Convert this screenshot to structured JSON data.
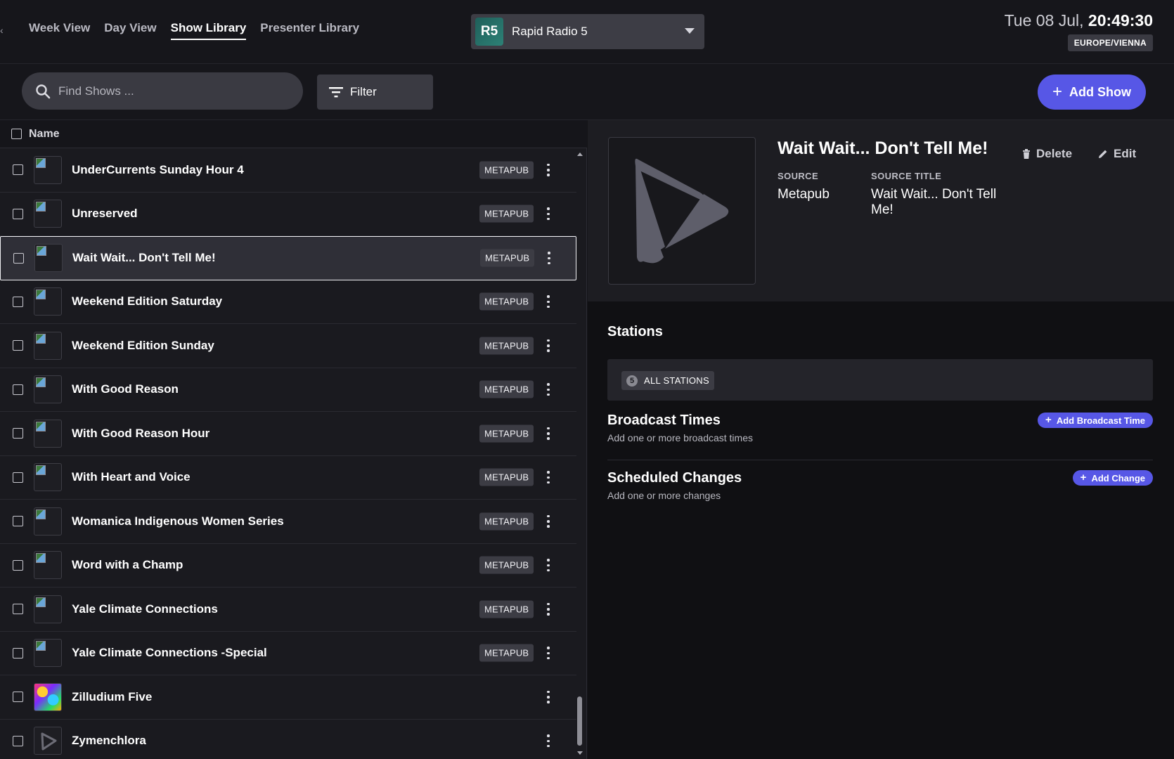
{
  "nav": {
    "back_glyph": "‹",
    "items": [
      {
        "label": "Week View"
      },
      {
        "label": "Day View"
      },
      {
        "label": "Show Library"
      },
      {
        "label": "Presenter Library"
      }
    ],
    "active_item": "Show Library"
  },
  "station_select": {
    "logo_text": "R5",
    "name": "Rapid Radio 5"
  },
  "clock": {
    "date": "Tue 08 Jul,",
    "time": "20:49:30",
    "timezone": "EUROPE/VIENNA"
  },
  "toolbar": {
    "search_placeholder": "Find Shows ...",
    "search_value": "",
    "filter_label": "Filter",
    "add_show_label": "Add Show"
  },
  "list": {
    "header_label": "Name",
    "rows": [
      {
        "title": "UnderCurrents Sunday Hour 4",
        "badge": "METAPUB",
        "thumb": "broken-image"
      },
      {
        "title": "Unreserved",
        "badge": "METAPUB",
        "thumb": "broken-image"
      },
      {
        "title": "Wait Wait... Don't Tell Me!",
        "badge": "METAPUB",
        "thumb": "broken-image"
      },
      {
        "title": "Weekend Edition Saturday",
        "badge": "METAPUB",
        "thumb": "broken-image"
      },
      {
        "title": "Weekend Edition Sunday",
        "badge": "METAPUB",
        "thumb": "broken-image"
      },
      {
        "title": "With Good Reason",
        "badge": "METAPUB",
        "thumb": "broken-image"
      },
      {
        "title": "With Good Reason Hour",
        "badge": "METAPUB",
        "thumb": "broken-image"
      },
      {
        "title": "With Heart and Voice",
        "badge": "METAPUB",
        "thumb": "broken-image"
      },
      {
        "title": "Womanica Indigenous Women Series",
        "badge": "METAPUB",
        "thumb": "broken-image"
      },
      {
        "title": "Word with a Champ",
        "badge": "METAPUB",
        "thumb": "broken-image"
      },
      {
        "title": "Yale Climate Connections",
        "badge": "METAPUB",
        "thumb": "broken-image"
      },
      {
        "title": "Yale Climate Connections -Special",
        "badge": "METAPUB",
        "thumb": "broken-image"
      },
      {
        "title": "Zilludium Five",
        "badge": "",
        "thumb": "colorful-artwork"
      },
      {
        "title": "Zymenchlora",
        "badge": "",
        "thumb": "play-logo"
      }
    ],
    "selected_title": "Wait Wait... Don't Tell Me!"
  },
  "detail": {
    "title": "Wait Wait... Don't Tell Me!",
    "source_label": "SOURCE",
    "source_value": "Metapub",
    "source_title_label": "SOURCE TITLE",
    "source_title_value": "Wait Wait... Don't Tell Me!",
    "delete_label": "Delete",
    "edit_label": "Edit",
    "stations_title": "Stations",
    "stations_count": "5",
    "stations_chip": "ALL STATIONS",
    "broadcast_title": "Broadcast Times",
    "broadcast_sub": "Add one or more broadcast times",
    "add_broadcast_label": "Add Broadcast Time",
    "changes_title": "Scheduled Changes",
    "changes_sub": "Add one or more changes",
    "add_change_label": "Add Change"
  },
  "colors": {
    "accent": "#5757e6",
    "background": "#141418",
    "panel": "#1d1d22",
    "badge": "#3c3c44"
  },
  "icons": {
    "search": "search-icon",
    "filter": "filter-icon",
    "plus": "plus-icon",
    "delete": "trash-icon",
    "edit": "pencil-icon",
    "row_menu": "kebab-menu-icon",
    "caret": "chevron-down-icon",
    "art_placeholder": "play-logo-icon"
  }
}
